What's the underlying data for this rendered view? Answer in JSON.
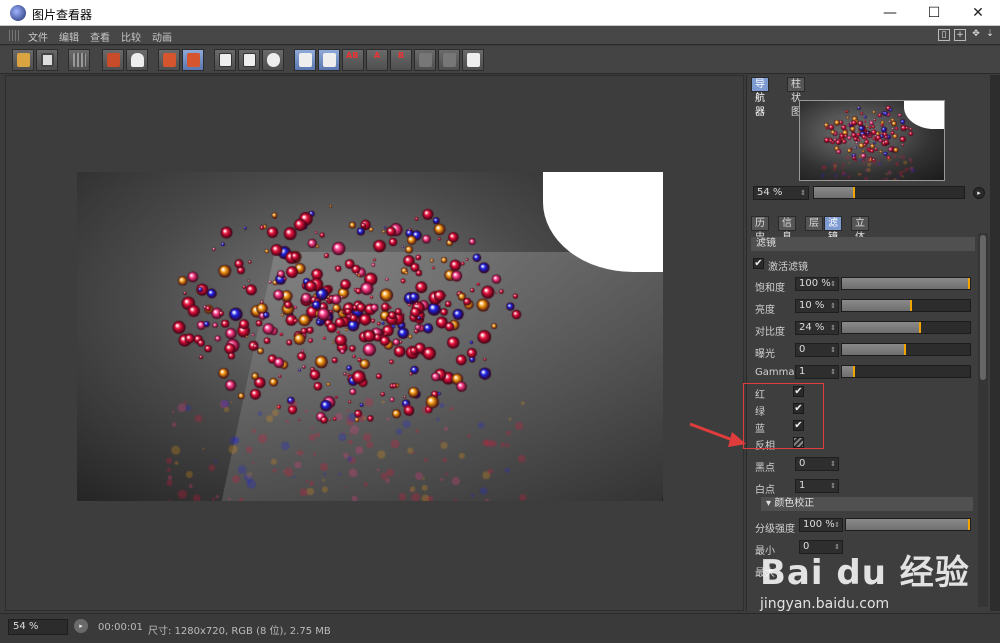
{
  "window": {
    "title": "图片查看器",
    "controls": {
      "minimize": "—",
      "maximize": "☐",
      "close": "✕"
    }
  },
  "menu": {
    "items": [
      "文件",
      "编辑",
      "查看",
      "比较",
      "动画"
    ]
  },
  "toolbar": {
    "buttons": [
      {
        "name": "open-file-button",
        "icon": "folder-icon"
      },
      {
        "name": "save-button",
        "icon": "save-icon"
      },
      {
        "name": "grid-button",
        "icon": "grid-icon"
      },
      {
        "name": "filmstrip-button",
        "icon": "filmstrip-icon"
      },
      {
        "name": "person-button",
        "icon": "person-icon"
      },
      {
        "name": "layers-button",
        "icon": "layers-icon"
      },
      {
        "name": "layers-alt-button",
        "icon": "layers-alt-icon"
      },
      {
        "name": "view-a-button",
        "icon": "view-icon"
      },
      {
        "name": "view-b-button",
        "icon": "view-icon"
      },
      {
        "name": "view-c-button",
        "icon": "view-icon"
      },
      {
        "name": "compare-a-button",
        "icon": "compare-icon"
      },
      {
        "name": "compare-b-button",
        "icon": "compare-icon"
      },
      {
        "name": "swap-ab-button",
        "icon": "ab-icon",
        "label": "AB"
      },
      {
        "name": "set-a-button",
        "icon": "a-icon",
        "label": "A"
      },
      {
        "name": "set-b-button",
        "icon": "b-icon",
        "label": "B"
      },
      {
        "name": "split-a-button",
        "icon": "split-icon"
      },
      {
        "name": "split-b-button",
        "icon": "split-icon"
      },
      {
        "name": "film-button",
        "icon": "film-icon"
      }
    ]
  },
  "status": {
    "zoom": "54 %",
    "time": "00:00:01",
    "info": "尺寸: 1280x720, RGB (8 位), 2.75 MB"
  },
  "navigator": {
    "tabs": [
      "导航器",
      "柱状图"
    ],
    "active_tab": 0,
    "zoom": "54 %",
    "zoom_fraction": 0.27
  },
  "filter_tabs": {
    "tabs": [
      "历史",
      "信息",
      "层",
      "滤镜",
      "立体"
    ],
    "active_tab": 3
  },
  "filter": {
    "section_title": "滤镜",
    "enable_label": "激活滤镜",
    "enable_checked": true,
    "sliders": [
      {
        "label": "饱和度",
        "value": "100 %",
        "fill": 1.0
      },
      {
        "label": "亮度",
        "value": "10 %",
        "fill": 0.55
      },
      {
        "label": "对比度",
        "value": "24 %",
        "fill": 0.62
      },
      {
        "label": "曝光",
        "value": "0",
        "fill": 0.5
      },
      {
        "label": "Gamma",
        "value": "1",
        "fill": 0.1
      }
    ],
    "channels": [
      {
        "label": "红",
        "checked": true
      },
      {
        "label": "绿",
        "checked": true
      },
      {
        "label": "蓝",
        "checked": true
      },
      {
        "label": "反相",
        "checked": false
      }
    ],
    "black_point_label": "黑点",
    "black_point": "0",
    "white_point_label": "白点",
    "white_point": "1",
    "color_correction_title": "▾ 颜色校正",
    "level_strength_label": "分级强度",
    "level_strength": "100 %",
    "level_strength_fill": 1.0,
    "min_label": "最小",
    "min_value": "0",
    "max_label": "最大"
  },
  "watermark": {
    "brand": "Bai du 经验",
    "url": "jingyan.baidu.com"
  },
  "colors": {
    "accent": "#7d9bd1",
    "slider_knob": "#f2a400",
    "highlight": "#e03c3c",
    "sphere_red": "#e8123c",
    "sphere_blue": "#1a22e8",
    "sphere_orange": "#f59a10"
  }
}
